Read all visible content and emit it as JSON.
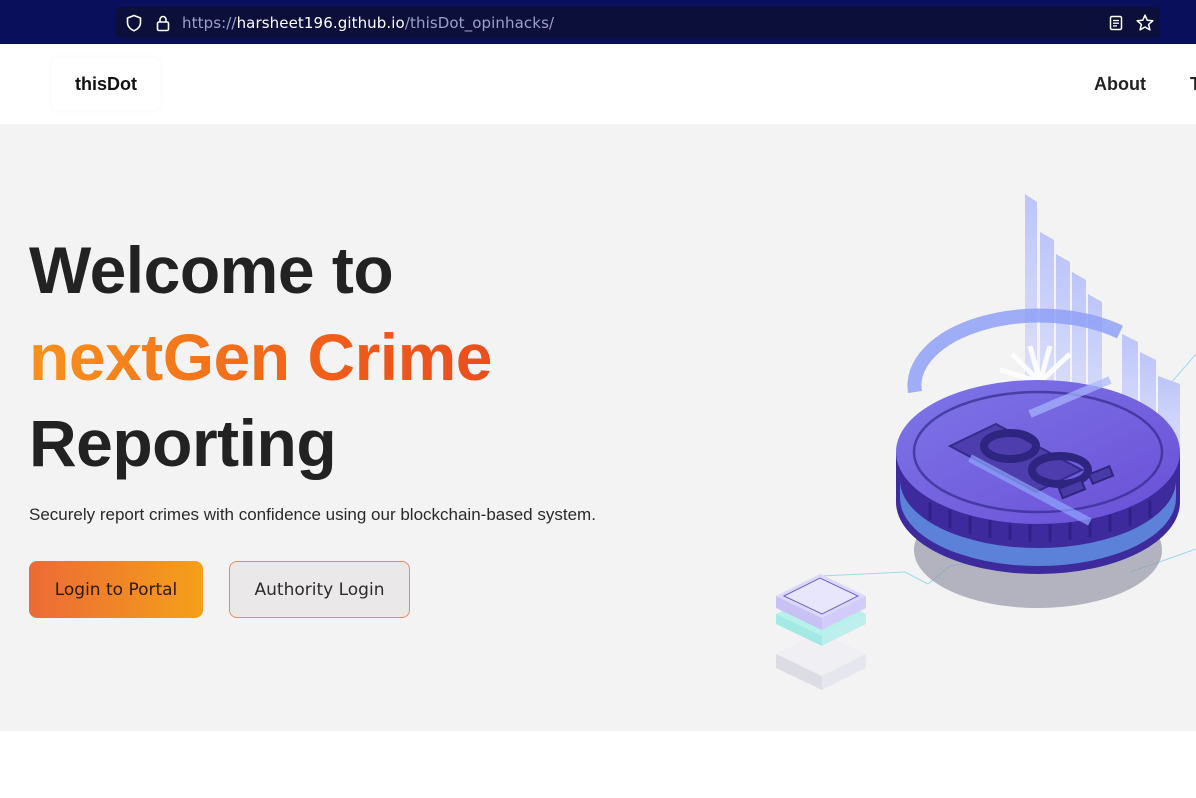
{
  "browser": {
    "url_prefix": "https://",
    "url_host": "harsheet196.github.io",
    "url_path": "/thisDot_opinhacks/"
  },
  "nav": {
    "logo": "thisDot",
    "about": "About",
    "overflow_item": "T"
  },
  "hero": {
    "title_line1": "Welcome to",
    "title_line2": "nextGen Crime",
    "title_line3": "Reporting",
    "subtitle": "Securely report crimes with confidence using our blockchain-based system.",
    "primary_button": "Login to Portal",
    "secondary_button": "Authority Login"
  },
  "colors": {
    "browser_bar": "#0a0f5c",
    "accent_start": "#f7921c",
    "accent_end": "#ea4e1e",
    "hero_bg": "#f3f3f4"
  },
  "icons": {
    "shield": "shield-icon",
    "lock": "lock-icon",
    "reader": "reader-view-icon",
    "bookmark": "bookmark-star-icon",
    "illustration": "blockchain-coin-illustration"
  }
}
